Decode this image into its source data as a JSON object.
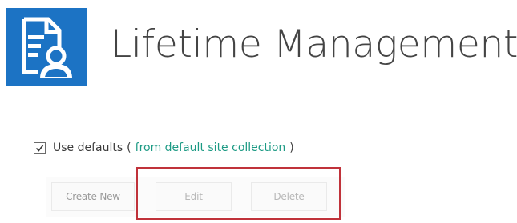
{
  "header": {
    "title": "Lifetime Management",
    "icon": "lifetime-management-app-icon",
    "icon_color": "#1c73c4"
  },
  "defaults": {
    "checkbox_checked": true,
    "label": "Use defaults",
    "open_paren": "(",
    "link_text": "from default site collection",
    "close_paren": ")",
    "link_color": "#1c9a84"
  },
  "toolbar": {
    "create_new_label": "Create New",
    "edit_label": "Edit",
    "delete_label": "Delete"
  },
  "annotation": {
    "highlight_color": "#c0323a"
  }
}
